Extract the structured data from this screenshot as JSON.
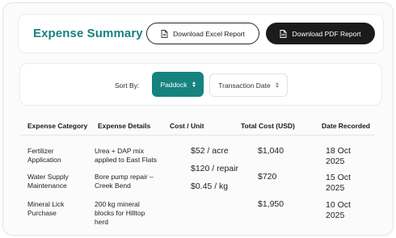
{
  "header": {
    "title": "Expense Summary",
    "excel_button": "Download Excel Report",
    "pdf_button": "Download PDF Report"
  },
  "sort": {
    "label": "Sort By:",
    "options": [
      {
        "label": "Paddock",
        "active": true
      },
      {
        "label": "Transaction Date",
        "active": false
      }
    ]
  },
  "table": {
    "columns": [
      "Expense Category",
      "Expense Details",
      "Cost / Unit",
      "Total Cost (USD)",
      "Date Recorded"
    ],
    "rows": [
      {
        "category": [
          "Fertilizer",
          "Application"
        ],
        "details": [
          "Urea + DAP mix",
          "applied to East Flats"
        ],
        "cost_unit": "$52 / acre",
        "total": "$1,040",
        "date": [
          "18 Oct",
          "2025"
        ]
      },
      {
        "category": [
          "Water Supply",
          "Maintenance"
        ],
        "details": [
          "Bore pump repair –",
          "Creek Bend"
        ],
        "cost_unit": "$120 / repair",
        "total": "$720",
        "date": [
          "15 Oct",
          "2025"
        ]
      },
      {
        "category": [
          "Mineral Lick",
          "Purchase"
        ],
        "details": [
          "200 kg mineral",
          "blocks for Hilltop",
          "herd"
        ],
        "cost_unit": "$0.45 / kg",
        "total": "$1,950",
        "date": [
          "10 Oct",
          "2025"
        ]
      }
    ]
  },
  "colors": {
    "accent": "#16837e",
    "dark_button": "#1b1b1b"
  },
  "icons": {
    "excel_button_icon": "document-icon",
    "pdf_button_icon": "document-icon",
    "sort_indicator": "sort-updown-icon"
  }
}
